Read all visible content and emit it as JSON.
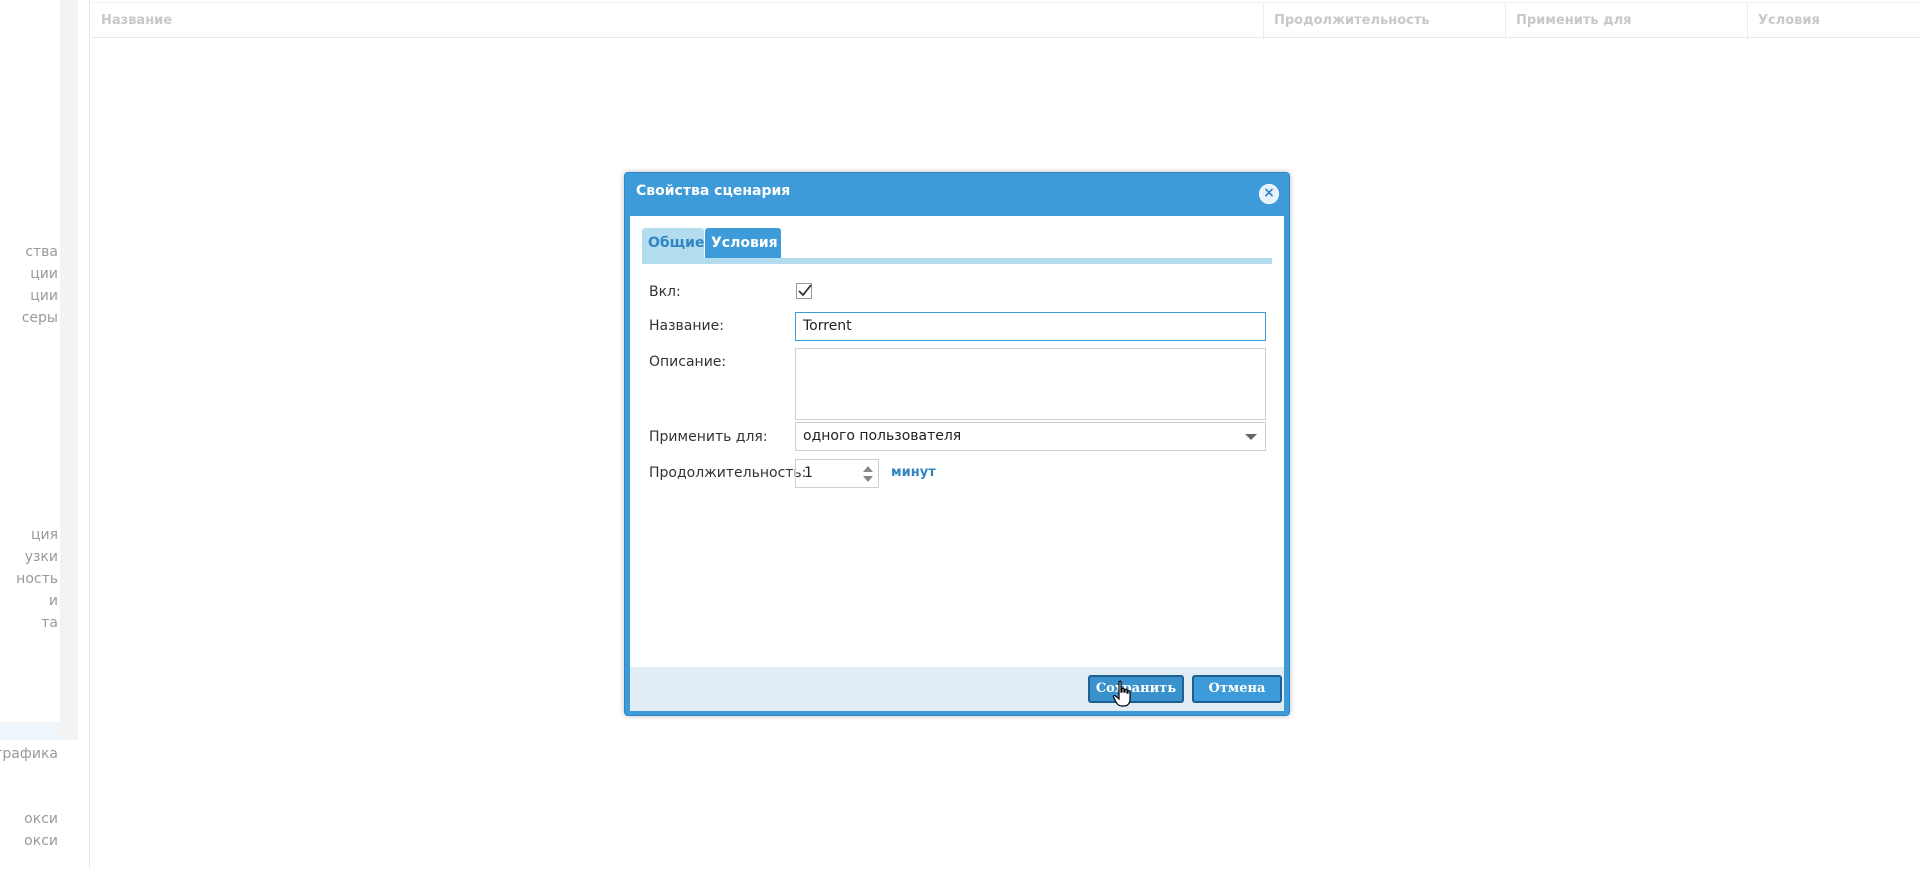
{
  "sidebar": {
    "items": [
      "ства",
      "ции",
      "ции",
      "серы",
      "ция",
      "узки",
      "ность",
      "и",
      "та",
      "трафика",
      "окси",
      "окси"
    ]
  },
  "grid": {
    "columns": [
      "Название",
      "Продолжительность",
      "Применить для",
      "Условия"
    ]
  },
  "dialog": {
    "title": "Свойства сценария",
    "tabs": [
      "Общие",
      "Условия"
    ],
    "fields": {
      "enabled_label": "Вкл:",
      "enabled": true,
      "name_label": "Название:",
      "name_value": "Torrent",
      "description_label": "Описание:",
      "description_value": "",
      "apply_label": "Применить для:",
      "apply_value": "одного пользователя",
      "duration_label": "Продолжительность:",
      "duration_value": "1",
      "duration_unit": "минут"
    },
    "buttons": {
      "save": "Сохранить",
      "cancel": "Отмена"
    }
  },
  "colors": {
    "accent": "#3d9bd9",
    "tab_inactive": "#b4dcef",
    "footer": "#e1ecf5"
  }
}
